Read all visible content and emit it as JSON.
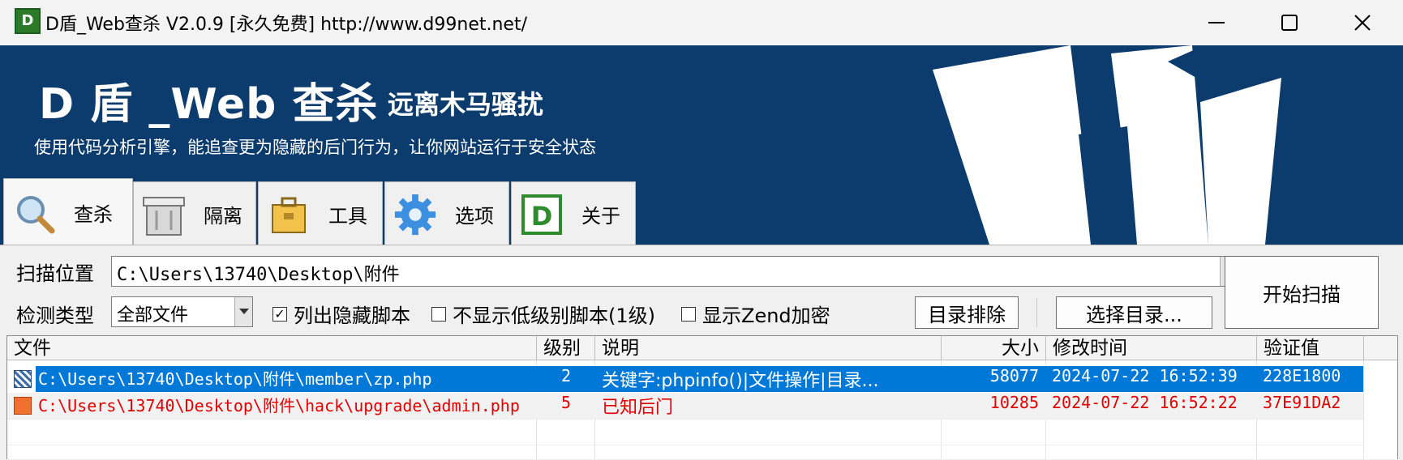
{
  "window": {
    "title": "D盾_Web查杀 V2.0.9 [永久免费] http://www.d99net.net/",
    "app_icon_letter": "D"
  },
  "banner": {
    "title": "D 盾 _Web 查杀",
    "subtitle": "远离木马骚扰",
    "description": "使用代码分析引擎，能追查更为隐藏的后门行为，让你网站运行于安全状态"
  },
  "tabs": [
    {
      "label": "查杀",
      "icon": "magnifier-icon"
    },
    {
      "label": "隔离",
      "icon": "bin-icon"
    },
    {
      "label": "工具",
      "icon": "toolbox-icon"
    },
    {
      "label": "选项",
      "icon": "gear-icon"
    },
    {
      "label": "关于",
      "icon": "d-logo-icon"
    }
  ],
  "scan": {
    "location_label": "扫描位置",
    "location_value": "C:\\Users\\13740\\Desktop\\附件",
    "type_label": "检测类型",
    "type_value": "全部文件",
    "check_hidden_label": "列出隐藏脚本",
    "check_hidden_checked": true,
    "check_lowlevel_label": "不显示低级别脚本(1级)",
    "check_lowlevel_checked": false,
    "check_zend_label": "显示Zend加密",
    "check_zend_checked": false,
    "exclude_dir_button": "目录排除",
    "choose_dir_button": "选择目录...",
    "start_button": "开始扫描"
  },
  "table": {
    "columns": [
      "文件",
      "级别",
      "说明",
      "大小",
      "修改时间",
      "验证值"
    ],
    "rows": [
      {
        "file": "C:\\Users\\13740\\Desktop\\附件\\member\\zp.php",
        "level": "2",
        "desc": "关键字:phpinfo()|文件操作|目录...",
        "size": "58077",
        "mtime": "2024-07-22 16:52:39",
        "hash": "228E1800",
        "selected": true
      },
      {
        "file": "C:\\Users\\13740\\Desktop\\附件\\hack\\upgrade\\admin.php",
        "level": "5",
        "desc": "已知后门",
        "size": "10285",
        "mtime": "2024-07-22 16:52:22",
        "hash": "37E91DA2",
        "selected": false
      }
    ]
  },
  "colors": {
    "banner_bg": "#0c3b6e",
    "selection": "#0078d7",
    "danger_text": "#e00000"
  }
}
